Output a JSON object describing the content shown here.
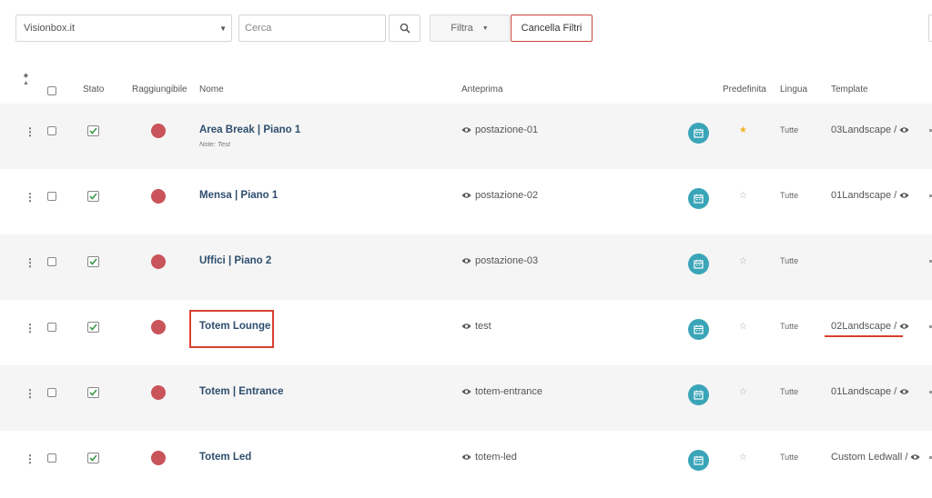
{
  "toolbar": {
    "site_select": "Visionbox.it",
    "search_placeholder": "Cerca",
    "filter_label": "Filtra",
    "clear_filters_label": "Cancella Filtri"
  },
  "columns": {
    "stato": "Stato",
    "raggiungibile": "Raggiungibile",
    "nome": "Nome",
    "anteprima": "Anteprima",
    "predefinita": "Predefinita",
    "lingua": "Lingua",
    "template": "Template"
  },
  "rows": [
    {
      "name": "Area Break | Piano 1",
      "note": "Note: Test",
      "preview": "postazione-01",
      "default": true,
      "lang": "Tutte",
      "template": "03Landscape /"
    },
    {
      "name": "Mensa | Piano 1",
      "note": "",
      "preview": "postazione-02",
      "default": false,
      "lang": "Tutte",
      "template": "01Landscape /"
    },
    {
      "name": "Uffici | Piano 2",
      "note": "",
      "preview": "postazione-03",
      "default": false,
      "lang": "Tutte",
      "template": ""
    },
    {
      "name": "Totem Lounge",
      "note": "",
      "preview": "test",
      "default": false,
      "lang": "Tutte",
      "template": "02Landscape /"
    },
    {
      "name": "Totem | Entrance",
      "note": "",
      "preview": "totem-entrance",
      "default": false,
      "lang": "Tutte",
      "template": "01Landscape /"
    },
    {
      "name": "Totem Led",
      "note": "",
      "preview": "totem-led",
      "default": false,
      "lang": "Tutte",
      "template": "Custom Ledwall /"
    }
  ],
  "colors": {
    "accent_red": "#d9412e",
    "status_red": "#c9545a",
    "teal": "#3aa5b8",
    "name_blue": "#2e4e6f",
    "star_gold": "#f0b323"
  }
}
